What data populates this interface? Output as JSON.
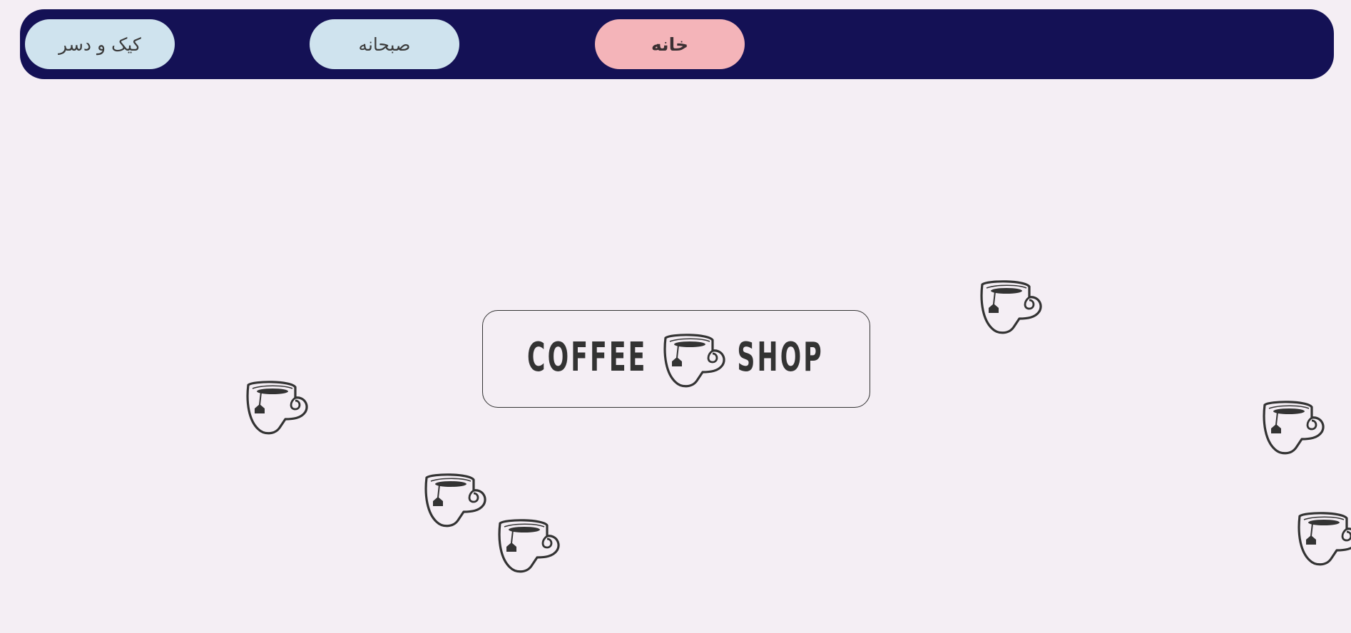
{
  "nav": {
    "items": [
      {
        "label": "کیک و دسر",
        "active": false
      },
      {
        "label": "صبحانه",
        "active": false
      },
      {
        "label": "خانه",
        "active": true
      }
    ]
  },
  "logo": {
    "word1": "COFFEE",
    "word2": "SHOP",
    "icon": "tea-cup-icon"
  },
  "decor": {
    "icon": "tea-cup-icon",
    "count": 6
  },
  "colors": {
    "background": "#f4eef4",
    "navbar": "#141155",
    "nav_button": "#cfe3ee",
    "nav_button_active": "#f4b4b9",
    "ink": "#333333"
  }
}
